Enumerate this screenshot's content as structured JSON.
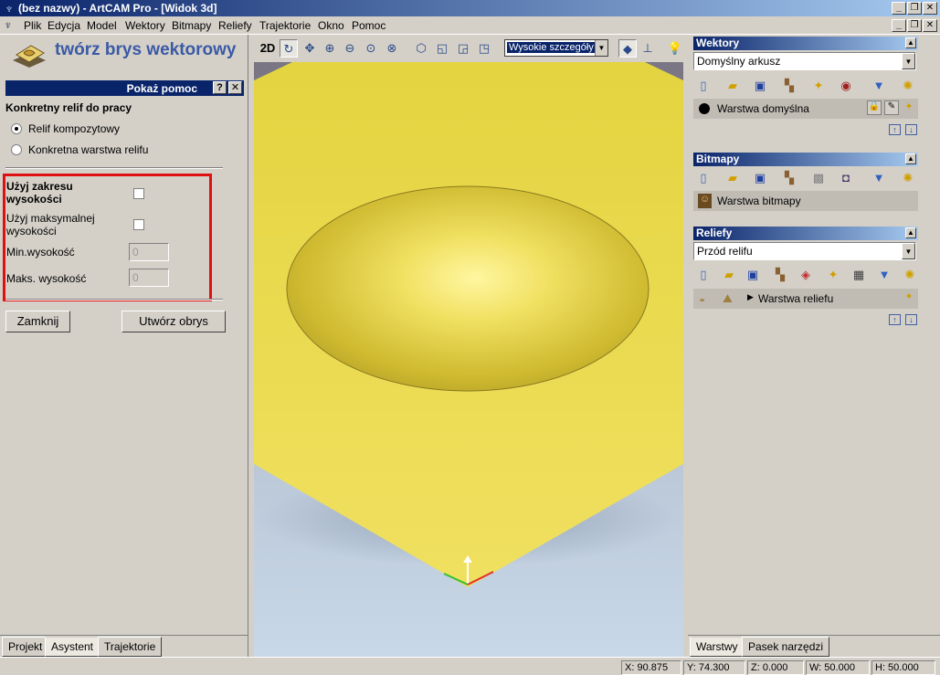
{
  "window": {
    "title": "(bez nazwy) - ArtCAM Pro - [Widok 3d]",
    "controls": [
      "_",
      "❐",
      "✕"
    ]
  },
  "menu": {
    "items": [
      "Plik",
      "Edycja",
      "Model",
      "Wektory",
      "Bitmapy",
      "Reliefy",
      "Trajektorie",
      "Okno",
      "Pomoc"
    ]
  },
  "assistant": {
    "title": "twórz brys wektorowy",
    "help_label": "Pokaż pomoc",
    "help_btn": "?",
    "close_btn": "✕",
    "section_heading": "Konkretny relif do pracy",
    "radio_composite": "Relif kompozytowy",
    "radio_layer": "Konkretna warstwa relifu",
    "opt_height_range": "Użyj zakresu wysokości",
    "opt_max_height": "Użyj maksymalnej wysokości",
    "min_label": "Min.wysokość",
    "min_value": "0",
    "max_label": "Maks. wysokość",
    "max_value": "0",
    "close_button": "Zamknij",
    "create_button": "Utwórz obrys",
    "selected_radio": "composite"
  },
  "left_tabs": [
    "Projekt",
    "Asystent",
    "Trajektorie"
  ],
  "view_toolbar": {
    "mode_2d": "2D",
    "quality": "Wysokie szczegóły"
  },
  "right_panel": {
    "vectors": {
      "header": "Wektory",
      "sheet": "Domyślny arkusz",
      "layer": "Warstwa domyślna"
    },
    "bitmaps": {
      "header": "Bitmapy",
      "layer": "Warstwa bitmapy"
    },
    "reliefs": {
      "header": "Reliefy",
      "combo": "Przód relifu",
      "layer": "Warstwa reliefu"
    },
    "tabs": [
      "Warstwy",
      "Pasek narzędzi"
    ]
  },
  "status": {
    "x": "X: 90.875",
    "y": "Y: 74.300",
    "z": "Z: 0.000",
    "w": "W: 50.000",
    "h": "H: 50.000"
  },
  "colors": {
    "title_bar": "#0a246a",
    "highlight_box": "#e01010",
    "relief_yellow": "#e8d848",
    "tool_title": "#3a5aa6"
  }
}
